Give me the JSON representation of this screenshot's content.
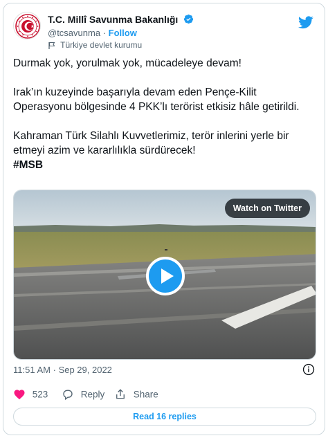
{
  "author": {
    "display_name": "T.C. Millî Savunma Bakanlığı",
    "handle": "@tcsavunma",
    "separator": "·",
    "follow_label": "Follow",
    "account_label": "Türkiye devlet kurumu",
    "verified": true
  },
  "tweet": {
    "paragraphs": [
      "Durmak yok, yorulmak yok, mücadeleye devam!",
      "Irak’ın kuzeyinde başarıyla devam eden Pençe-Kilit Operasyonu bölgesinde 4 PKK’lı terörist etkisiz hâle getirildi.",
      "Kahraman Türk Silahlı Kuvvetlerimiz, terör inlerini yerle bir etmeyi azim ve kararlılıkla sürdürecek!"
    ],
    "hashtag": "#MSB"
  },
  "media": {
    "watch_label": "Watch on Twitter",
    "play_icon": "play-icon"
  },
  "meta": {
    "time": "11:51 AM",
    "separator": "·",
    "date": "Sep 29, 2022"
  },
  "actions": {
    "like_count": "523",
    "reply_label": "Reply",
    "share_label": "Share"
  },
  "read_replies_label": "Read 16 replies",
  "colors": {
    "accent": "#1d9bf0",
    "like": "#f91880",
    "text": "#0f1419",
    "secondary": "#536471",
    "border": "#cfd9de",
    "seal_red": "#c8102e"
  }
}
